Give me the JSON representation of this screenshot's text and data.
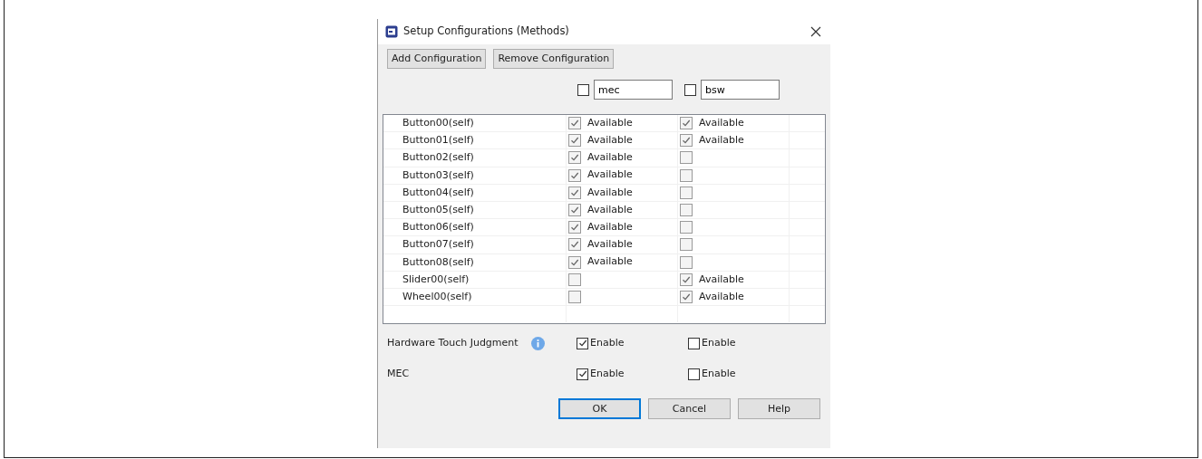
{
  "window": {
    "title": "Setup Configurations (Methods)"
  },
  "toolbar": [
    {
      "label": "Add Configuration"
    },
    {
      "label": "Remove Configuration"
    }
  ],
  "configurations": [
    {
      "checked": false,
      "value": "mec"
    },
    {
      "checked": false,
      "value": "bsw"
    }
  ],
  "table": {
    "rows": [
      {
        "name": "Button00(self)",
        "cells": [
          {
            "checked": true,
            "label": "Available"
          },
          {
            "checked": true,
            "label": "Available"
          }
        ]
      },
      {
        "name": "Button01(self)",
        "cells": [
          {
            "checked": true,
            "label": "Available"
          },
          {
            "checked": true,
            "label": "Available"
          }
        ]
      },
      {
        "name": "Button02(self)",
        "cells": [
          {
            "checked": true,
            "label": "Available"
          },
          {
            "checked": false
          }
        ]
      },
      {
        "name": "Button03(self)",
        "cells": [
          {
            "checked": true,
            "label": "Available"
          },
          {
            "checked": false
          }
        ]
      },
      {
        "name": "Button04(self)",
        "cells": [
          {
            "checked": true,
            "label": "Available"
          },
          {
            "checked": false
          }
        ]
      },
      {
        "name": "Button05(self)",
        "cells": [
          {
            "checked": true,
            "label": "Available"
          },
          {
            "checked": false
          }
        ]
      },
      {
        "name": "Button06(self)",
        "cells": [
          {
            "checked": true,
            "label": "Available"
          },
          {
            "checked": false
          }
        ]
      },
      {
        "name": "Button07(self)",
        "cells": [
          {
            "checked": true,
            "label": "Available"
          },
          {
            "checked": false
          }
        ]
      },
      {
        "name": "Button08(self)",
        "cells": [
          {
            "checked": true,
            "label": "Available"
          },
          {
            "checked": false
          }
        ]
      },
      {
        "name": "Slider00(self)",
        "cells": [
          {
            "checked": false
          },
          {
            "checked": true,
            "label": "Available"
          }
        ]
      },
      {
        "name": "Wheel00(self)",
        "cells": [
          {
            "checked": false
          },
          {
            "checked": true,
            "label": "Available"
          }
        ]
      }
    ]
  },
  "options": [
    {
      "label": "Hardware Touch Judgment",
      "info": true,
      "cells": [
        {
          "checked": true,
          "label": "Enable"
        },
        {
          "checked": false,
          "label": "Enable"
        }
      ]
    },
    {
      "label": "MEC",
      "info": false,
      "cells": [
        {
          "checked": true,
          "label": "Enable"
        },
        {
          "checked": false,
          "label": "Enable"
        }
      ]
    }
  ],
  "buttons": [
    {
      "label": "OK",
      "default": true
    },
    {
      "label": "Cancel",
      "default": false
    },
    {
      "label": "Help",
      "default": false
    }
  ]
}
